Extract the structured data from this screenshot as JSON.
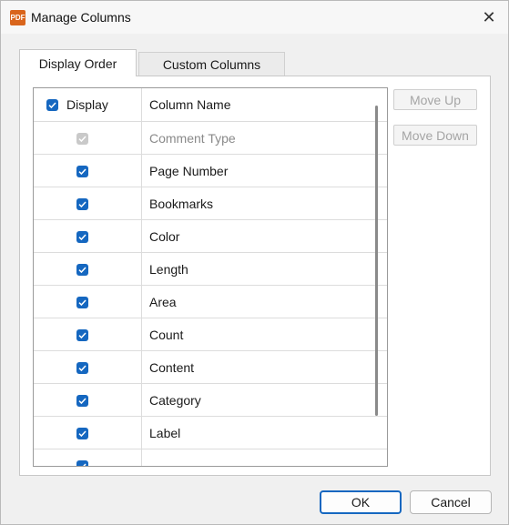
{
  "window": {
    "title": "Manage Columns",
    "app_icon_text": "PDF",
    "close_glyph": "✕"
  },
  "tabs": [
    {
      "label": "Display Order",
      "active": true
    },
    {
      "label": "Custom Columns",
      "active": false
    }
  ],
  "grid": {
    "header_display": "Display",
    "header_name": "Column Name",
    "rows": [
      {
        "name": "Comment Type",
        "checked": true,
        "disabled": true
      },
      {
        "name": "Page Number",
        "checked": true,
        "disabled": false
      },
      {
        "name": "Bookmarks",
        "checked": true,
        "disabled": false
      },
      {
        "name": "Color",
        "checked": true,
        "disabled": false
      },
      {
        "name": "Length",
        "checked": true,
        "disabled": false
      },
      {
        "name": "Area",
        "checked": true,
        "disabled": false
      },
      {
        "name": "Count",
        "checked": true,
        "disabled": false
      },
      {
        "name": "Content",
        "checked": true,
        "disabled": false
      },
      {
        "name": "Category",
        "checked": true,
        "disabled": false
      },
      {
        "name": "Label",
        "checked": true,
        "disabled": false
      },
      {
        "name": "",
        "checked": true,
        "disabled": false
      }
    ]
  },
  "side_buttons": {
    "move_up": "Move Up",
    "move_down": "Move Down"
  },
  "footer": {
    "ok": "OK",
    "cancel": "Cancel"
  },
  "colors": {
    "accent": "#1567c0",
    "disabled_check": "#c9c9c9"
  }
}
